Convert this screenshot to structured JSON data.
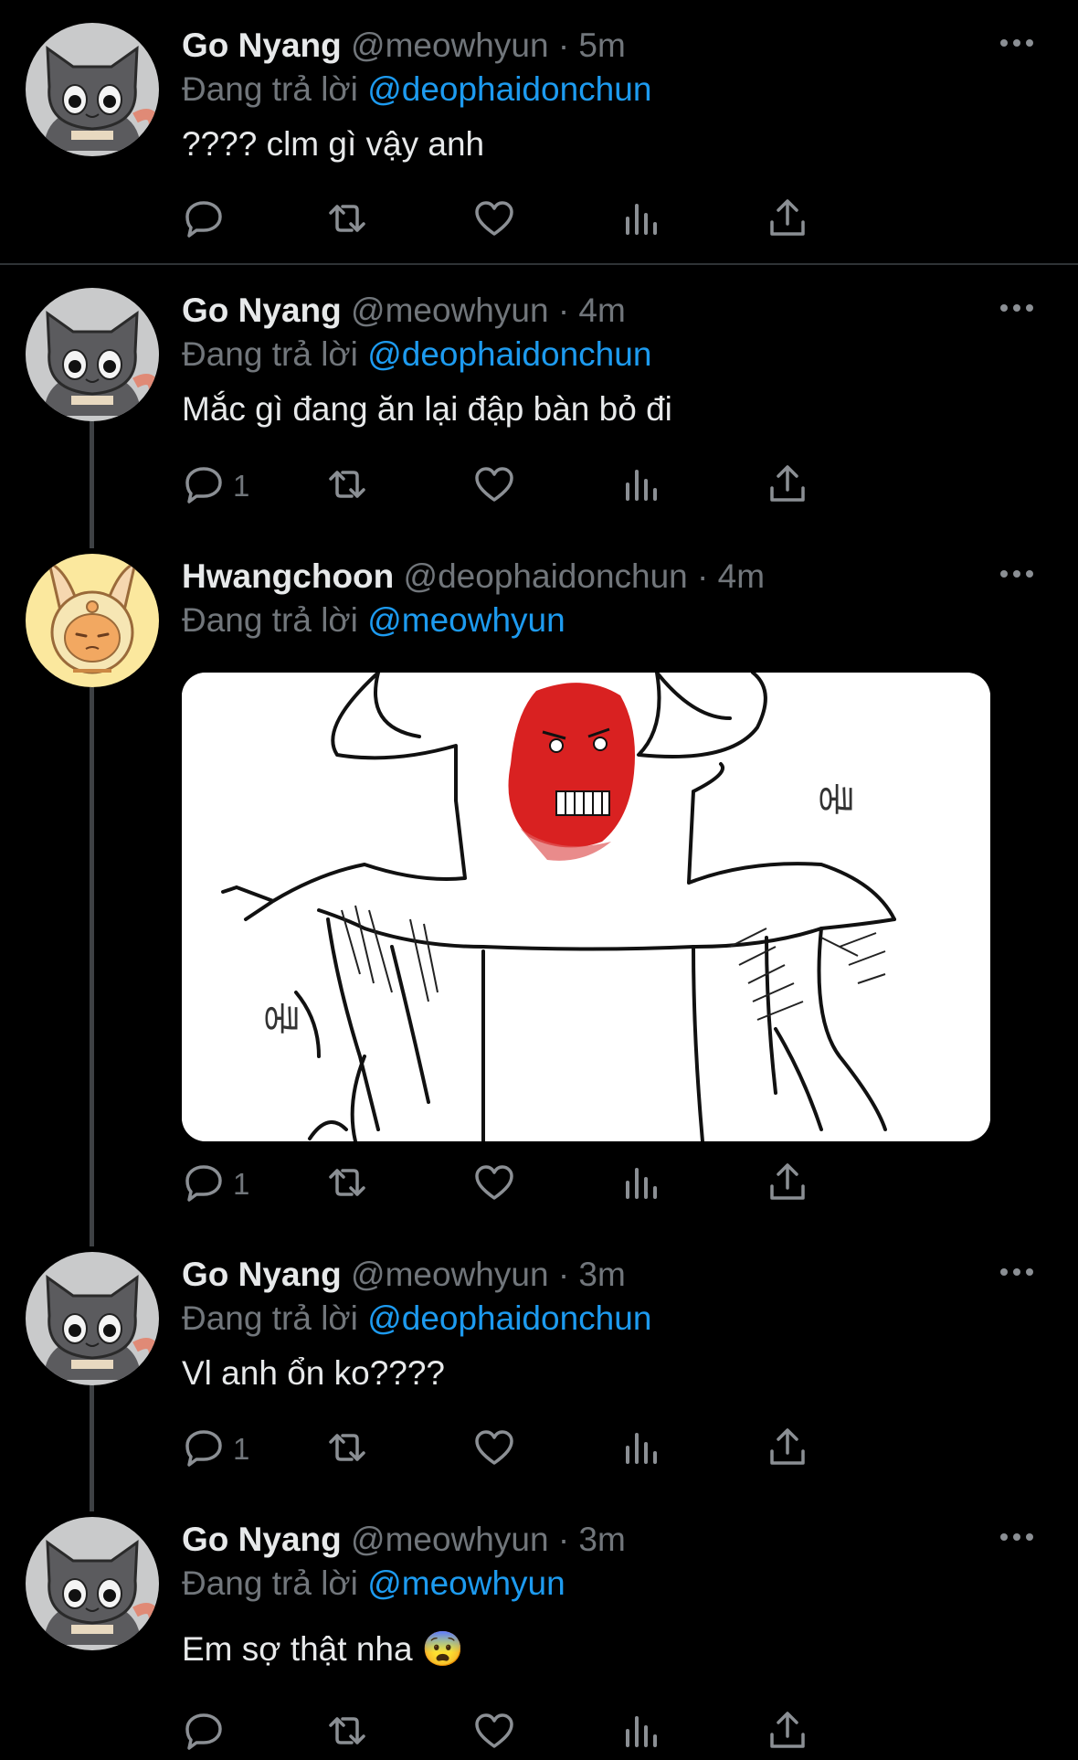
{
  "tweets": [
    {
      "name": "Go Nyang",
      "handle": "@meowhyun",
      "dot": "·",
      "time": "5m",
      "reply_prefix": "Đang trả lời ",
      "reply_to": "@deophaidonchun",
      "text": "???? clm gì vậy anh",
      "replies": ""
    },
    {
      "name": "Go Nyang",
      "handle": "@meowhyun",
      "dot": "·",
      "time": "4m",
      "reply_prefix": "Đang trả lời ",
      "reply_to": "@deophaidonchun",
      "text": "Mắc gì đang ăn lại đập bàn bỏ đi",
      "replies": "1"
    },
    {
      "name": "Hwangchoon",
      "handle": "@deophaidonchun",
      "dot": "·",
      "time": "4m",
      "reply_prefix": "Đang trả lời ",
      "reply_to": "@meowhyun",
      "text": "",
      "replies": "1",
      "media_text_1": "쿵",
      "media_text_2": "쿵"
    },
    {
      "name": "Go Nyang",
      "handle": "@meowhyun",
      "dot": "·",
      "time": "3m",
      "reply_prefix": "Đang trả lời ",
      "reply_to": "@deophaidonchun",
      "text": "Vl anh ổn ko????",
      "replies": "1"
    },
    {
      "name": "Go Nyang",
      "handle": "@meowhyun",
      "dot": "·",
      "time": "3m",
      "reply_prefix": "Đang trả lời ",
      "reply_to": "@meowhyun",
      "text": "Em sợ thật nha 😨",
      "replies": ""
    }
  ],
  "colors": {
    "background": "#000000",
    "text": "#e7e9ea",
    "muted": "#71767b",
    "link": "#1d9bf0",
    "divider": "#2f3336"
  },
  "icons": [
    "reply-icon",
    "retweet-icon",
    "like-icon",
    "views-icon",
    "share-icon",
    "more-icon"
  ]
}
